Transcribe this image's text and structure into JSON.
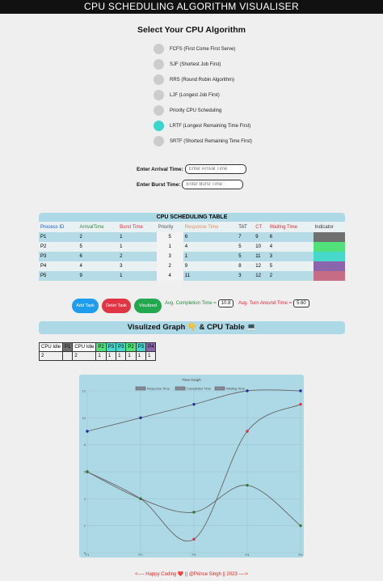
{
  "header": {
    "title": "CPU SCHEDULING ALGORITHM VISUALISER"
  },
  "algorithms": {
    "heading": "Select Your CPU Algorithm",
    "items": [
      {
        "label": "FCFS (First Come First Serve)",
        "selected": false
      },
      {
        "label": "SJF (Shortest Job First)",
        "selected": false
      },
      {
        "label": "RRS (Round Robin Algorithm)",
        "selected": false
      },
      {
        "label": "LJF (Longest Job First)",
        "selected": false
      },
      {
        "label": "Priority CPU Scheduling",
        "selected": false
      },
      {
        "label": "LRTF (Longest Remaining Time First)",
        "selected": true
      },
      {
        "label": "SRTF (Shortest Remaining Time First)",
        "selected": false
      }
    ]
  },
  "inputs": {
    "arrival_label": "Enter Arrival Time:",
    "arrival_placeholder": "Enter Arrival Time",
    "burst_label": "Enter Burst Time:",
    "burst_placeholder": "Enter Burst Time"
  },
  "table": {
    "title": "CPU SCHEDULING TABLE",
    "headers": [
      "Process ID",
      "ArrivalTime",
      "Burst Time",
      "Priority",
      "Response Time",
      "TAT",
      "CT",
      "Waiting Time",
      "Indicator"
    ],
    "header_colors": [
      "#1a56c4",
      "#2d8a3e",
      "#d9303c",
      "#555555",
      "#e08f62",
      "#333333",
      "#d9303c",
      "#d9303c",
      "#333333"
    ],
    "rows": [
      {
        "cells": [
          "P1",
          "2",
          "1",
          "5",
          "6",
          "7",
          "9",
          "6"
        ],
        "indicator_color": "#707070"
      },
      {
        "cells": [
          "P2",
          "5",
          "1",
          "1",
          "4",
          "5",
          "10",
          "4"
        ],
        "indicator_color": "#52e07a"
      },
      {
        "cells": [
          "P3",
          "6",
          "2",
          "3",
          "1",
          "5",
          "11",
          "3"
        ],
        "indicator_color": "#47d8cc"
      },
      {
        "cells": [
          "P4",
          "4",
          "3",
          "2",
          "9",
          "8",
          "12",
          "5"
        ],
        "indicator_color": "#8c66ad"
      },
      {
        "cells": [
          "P5",
          "9",
          "1",
          "4",
          "11",
          "3",
          "12",
          "2"
        ],
        "indicator_color": "#c66c84"
      }
    ]
  },
  "buttons": {
    "add": "Add Task",
    "delete": "Delet Task",
    "visualize": "Visulized"
  },
  "averages": {
    "completion_label": "Avg. Completion Time =",
    "completion_value": "10.8",
    "tat_label": "Avg. Turn Around Time =",
    "tat_value": "5.60"
  },
  "section2": {
    "title": "Visulized Graph 👇 & CPU Table 💻"
  },
  "gantt": {
    "labels": [
      "CPU Idle",
      "P1",
      "CPU Idle",
      "P2",
      "P3",
      "P3",
      "P2",
      "P3",
      "P4"
    ],
    "colors": [
      "#ffffff",
      "#707070",
      "#ffffff",
      "#52e07a",
      "#47d8cc",
      "#47d8cc",
      "#52e07a",
      "#47d8cc",
      "#8c66ad"
    ],
    "times": [
      "2",
      "",
      "2",
      "1",
      "1",
      "1",
      "1",
      "1",
      "1"
    ]
  },
  "chart_data": {
    "type": "line",
    "title": "Time Graph",
    "categories": [
      "P1",
      "P2",
      "P3",
      "P4",
      "P5"
    ],
    "ylim": [
      0,
      12
    ],
    "yticks": [
      "0",
      "2",
      "4",
      "6",
      "8",
      "10",
      "12"
    ],
    "legend_position": "top",
    "series": [
      {
        "name": "Response Time",
        "values": [
          6,
          4,
          1,
          9,
          11
        ],
        "color": "#d9303c"
      },
      {
        "name": "Completion Time",
        "values": [
          9,
          10,
          11,
          12,
          12
        ],
        "color": "#1f2f9e"
      },
      {
        "name": "Waiting Time",
        "values": [
          6,
          4,
          3,
          5,
          2
        ],
        "color": "#2f7a3a"
      }
    ]
  },
  "footer": {
    "text": "<---- Happy Coding ❤️ || @Prince Singh || 2023 ---->"
  }
}
